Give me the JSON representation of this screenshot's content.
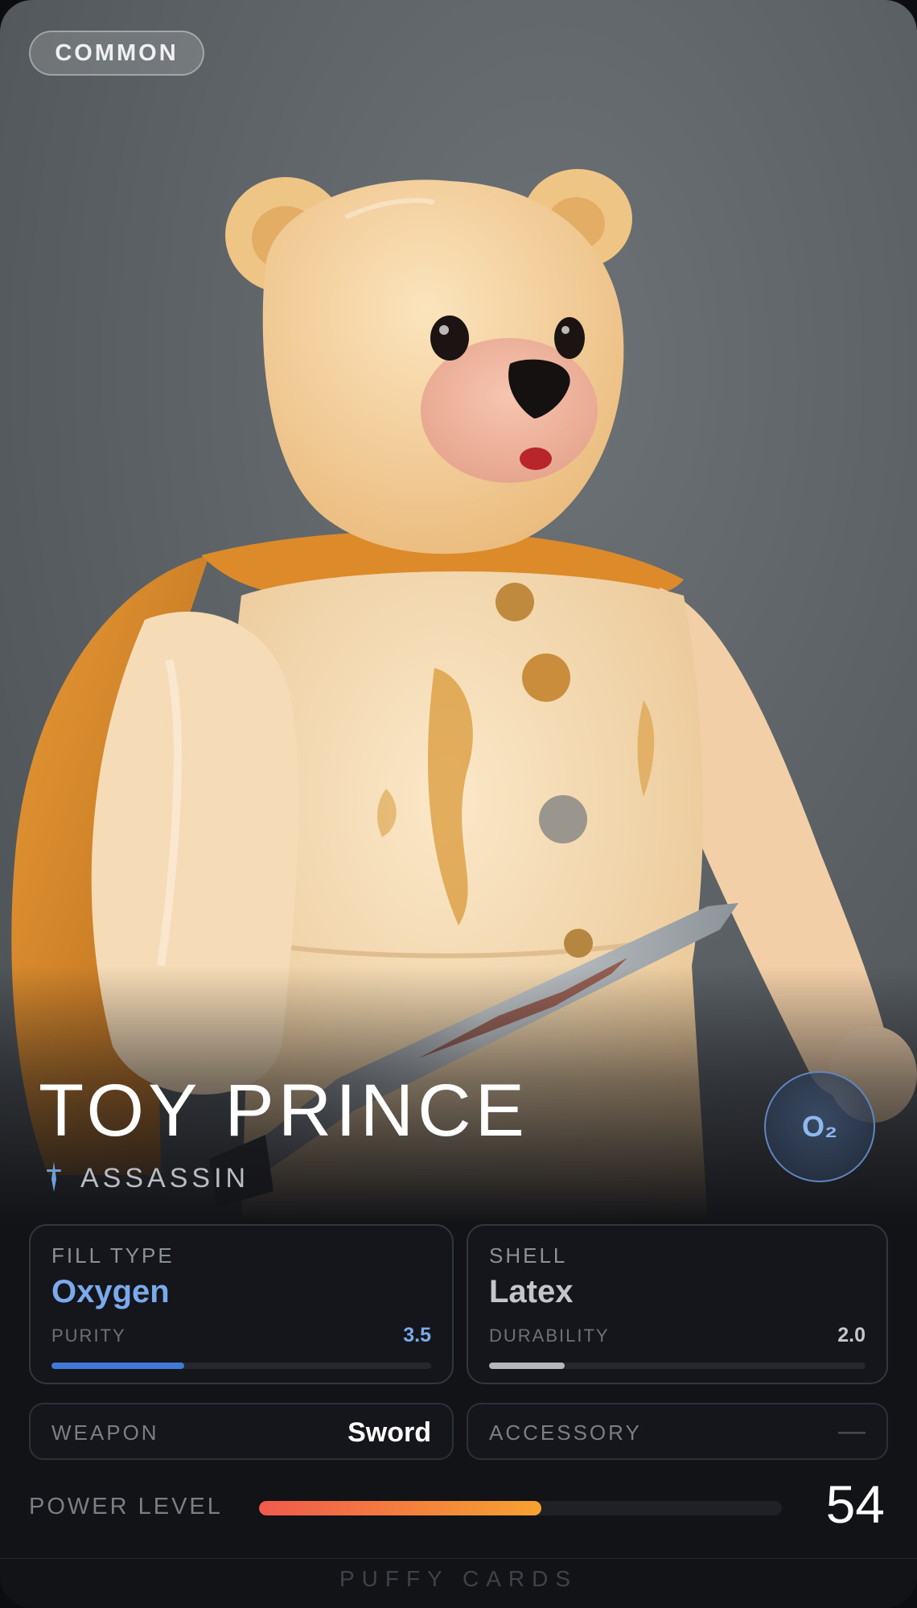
{
  "card": {
    "rarity": "COMMON",
    "name": "TOY PRINCE",
    "class": "ASSASSIN",
    "class_icon": "dagger-icon",
    "element_badge": "O₂",
    "artwork": "inflatable-teddy-bear-with-cape-and-sword",
    "colors": {
      "accent_blue": "#7aa9ec",
      "fill_bar": "#3f7bd6",
      "shell_bar": "#b5b7bb",
      "power_start": "#ef5a4d",
      "power_end": "#f6a230"
    }
  },
  "stats": {
    "fill": {
      "label": "FILL TYPE",
      "value": "Oxygen",
      "sub_label": "PURITY",
      "sub_value": "3.5",
      "level": 0.35
    },
    "shell": {
      "label": "SHELL",
      "value": "Latex",
      "sub_label": "DURABILITY",
      "sub_value": "2.0",
      "level": 0.2
    }
  },
  "slots": {
    "weapon": {
      "label": "WEAPON",
      "value": "Sword"
    },
    "accessory": {
      "label": "ACCESSORY",
      "value": "—"
    }
  },
  "power": {
    "label": "POWER LEVEL",
    "value": "54",
    "level": 0.54
  },
  "footer": "PUFFY CARDS"
}
